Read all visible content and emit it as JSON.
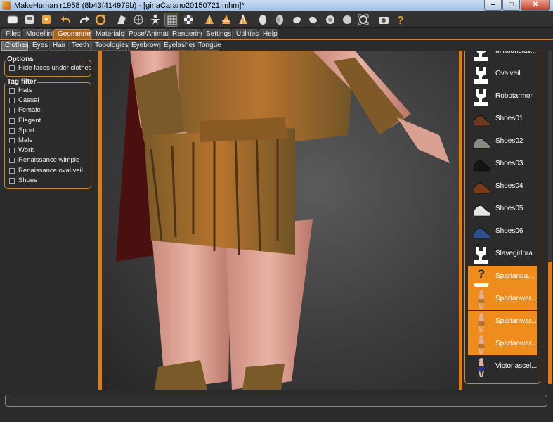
{
  "window": {
    "title": "MakeHuman r1958 (8b43f414979b) - [ginaCarano20150721.mhm]*"
  },
  "toolbar": {
    "icons": [
      "file-icon",
      "save-icon",
      "export-icon",
      "undo-icon",
      "redo-icon",
      "reset-icon",
      "smooth-icon",
      "wireframe-icon",
      "pose-icon",
      "grid-icon",
      "background-icon",
      "front-view-icon",
      "back-view-icon",
      "side-view-icon",
      "head-icon",
      "left-view-icon",
      "right-view-icon",
      "top-view-icon",
      "bottom-view-icon",
      "reset-camera-icon",
      "screenshot-icon",
      "help-icon"
    ],
    "help_label": "?"
  },
  "main_tabs": [
    {
      "label": "Files"
    },
    {
      "label": "Modelling"
    },
    {
      "label": "Geometries",
      "active": true
    },
    {
      "label": "Materials"
    },
    {
      "label": "Pose/Animate"
    },
    {
      "label": "Rendering"
    },
    {
      "label": "Settings"
    },
    {
      "label": "Utilities"
    },
    {
      "label": "Help"
    }
  ],
  "sub_tabs": [
    {
      "label": "Clothes",
      "active": true
    },
    {
      "label": "Eyes"
    },
    {
      "label": "Hair"
    },
    {
      "label": "Teeth"
    },
    {
      "label": "Topologies"
    },
    {
      "label": "Eyebrows"
    },
    {
      "label": "Eyelashes"
    },
    {
      "label": "Tongue"
    }
  ],
  "options": {
    "title": "Options",
    "hide_faces_label": "Hide faces under clothes",
    "hide_faces_checked": false
  },
  "tag_filter": {
    "title": "Tag filter",
    "tags": [
      "Hats",
      "Casual",
      "Female",
      "Elegant",
      "Sport",
      "Male",
      "Work",
      "Renaissance wimple",
      "Renaissance oval veil",
      "Shoes"
    ]
  },
  "clothes_list": [
    {
      "label": "Minoanslav...",
      "thumb": "placeholder",
      "selected": false
    },
    {
      "label": "Ovalveil",
      "thumb": "placeholder",
      "selected": false
    },
    {
      "label": "Robotarmor",
      "thumb": "placeholder",
      "selected": false
    },
    {
      "label": "Shoes01",
      "thumb": "shoe",
      "color": "#6b3a1e",
      "selected": false
    },
    {
      "label": "Shoes02",
      "thumb": "shoe",
      "color": "#8a8a80",
      "selected": false
    },
    {
      "label": "Shoes03",
      "thumb": "shoe",
      "color": "#151515",
      "selected": false
    },
    {
      "label": "Shoes04",
      "thumb": "shoe",
      "color": "#7a3a1a",
      "selected": false
    },
    {
      "label": "Shoes05",
      "thumb": "shoe",
      "color": "#e6e6e6",
      "selected": false
    },
    {
      "label": "Shoes06",
      "thumb": "shoe",
      "color": "#2d4f8c",
      "selected": false
    },
    {
      "label": "Slavegirlbra",
      "thumb": "placeholder",
      "selected": false
    },
    {
      "label": "Spartangau...",
      "thumb": "unknown",
      "selected": true
    },
    {
      "label": "Spartanwar...",
      "thumb": "figure",
      "selected": true
    },
    {
      "label": "Spartanwar...",
      "thumb": "figure",
      "selected": true
    },
    {
      "label": "Spartanwar...",
      "thumb": "figure",
      "selected": true
    },
    {
      "label": "Victoriascel...",
      "thumb": "figure-dress",
      "selected": false
    }
  ],
  "colors": {
    "accent": "#e07a12",
    "selection": "#ef8d1c",
    "panel": "#2b2b2b"
  }
}
